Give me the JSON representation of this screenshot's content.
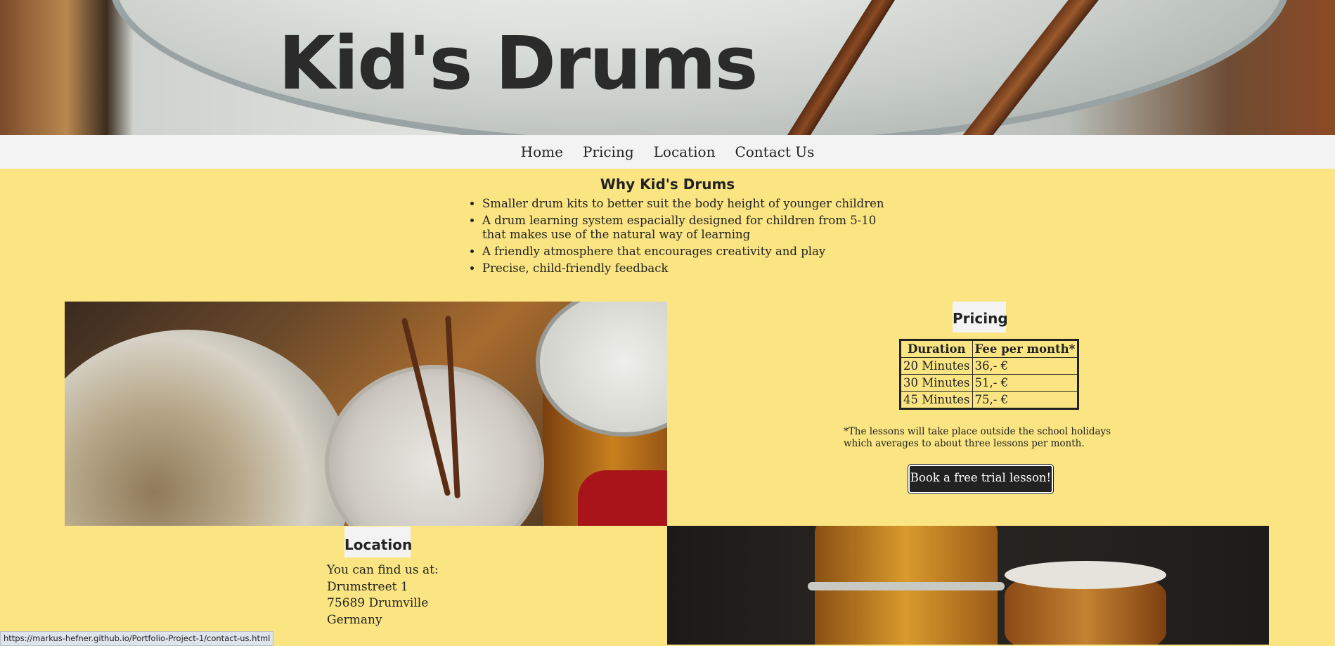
{
  "header": {
    "title": "Kid's Drums"
  },
  "nav": {
    "items": [
      "Home",
      "Pricing",
      "Location",
      "Contact Us"
    ]
  },
  "why": {
    "title": "Why Kid's Drums",
    "items": [
      "Smaller drum kits to better suit the body height of younger children",
      "A drum learning system espacially designed for children from 5-10 that makes use of the natural way of learning",
      "A friendly atmosphere that encourages creativity and play",
      "Precise, child-friendly feedback"
    ]
  },
  "pricing": {
    "title": "Pricing",
    "columns": [
      "Duration",
      "Fee per month*"
    ],
    "rows": [
      [
        "20 Minutes",
        "36,- €"
      ],
      [
        "30 Minutes",
        "51,- €"
      ],
      [
        "45 Minutes",
        "75,- €"
      ]
    ],
    "note": "*The lessons will take place outside the school holidays which averages to about three lessons per month.",
    "button": "Book a free trial lesson!"
  },
  "location": {
    "title": "Location",
    "lines": [
      "You can find us at:",
      "Drumstreet 1",
      "75689 Drumville",
      "Germany"
    ]
  },
  "status_bar": {
    "url": "https://markus-hefner.github.io/Portfolio-Project-1/contact-us.html"
  }
}
